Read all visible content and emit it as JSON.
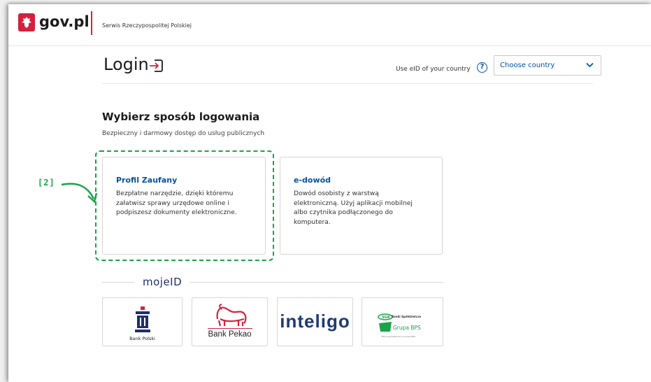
{
  "header": {
    "logo_text": "gov.pl",
    "service_name": "Serwis Rzeczypospolitej Polskiej"
  },
  "login": {
    "title": "Login",
    "eid_label": "Use eID of your country",
    "help_icon": "?",
    "country_select_value": "Choose country"
  },
  "section": {
    "title": "Wybierz sposób logowania",
    "subtitle": "Bezpieczny i darmowy dostęp do usług publicznych"
  },
  "cards": [
    {
      "title": "Profil Zaufany",
      "lines": [
        "Bezpłatne narzędzie, dzięki któremu",
        "załatwisz sprawy urzędowe online i",
        "podpiszesz dokumenty elektroniczne."
      ]
    },
    {
      "title": "e-dowód",
      "lines": [
        "Dowód osobisty z warstwą",
        "elektroniczną. Użyj aplikacji mobilnej",
        "albo czytnika podłączonego do",
        "komputera."
      ]
    }
  ],
  "annotation": {
    "label": "[2]",
    "color": "#1aa34a"
  },
  "mojeid": {
    "label": "mojeID"
  },
  "banks": [
    {
      "name": "Bank Polski"
    },
    {
      "name": "Bank Pekao"
    },
    {
      "name": "inteligo"
    },
    {
      "name": "Grupa BPS",
      "top_text": "Banki Spółdzielcze",
      "foot_text": "Bank Spółdzielczy w Grupie BPS"
    }
  ],
  "colors": {
    "brand_red": "#d4213d",
    "link_blue": "#0052a5",
    "annotation_green": "#1aa34a"
  }
}
